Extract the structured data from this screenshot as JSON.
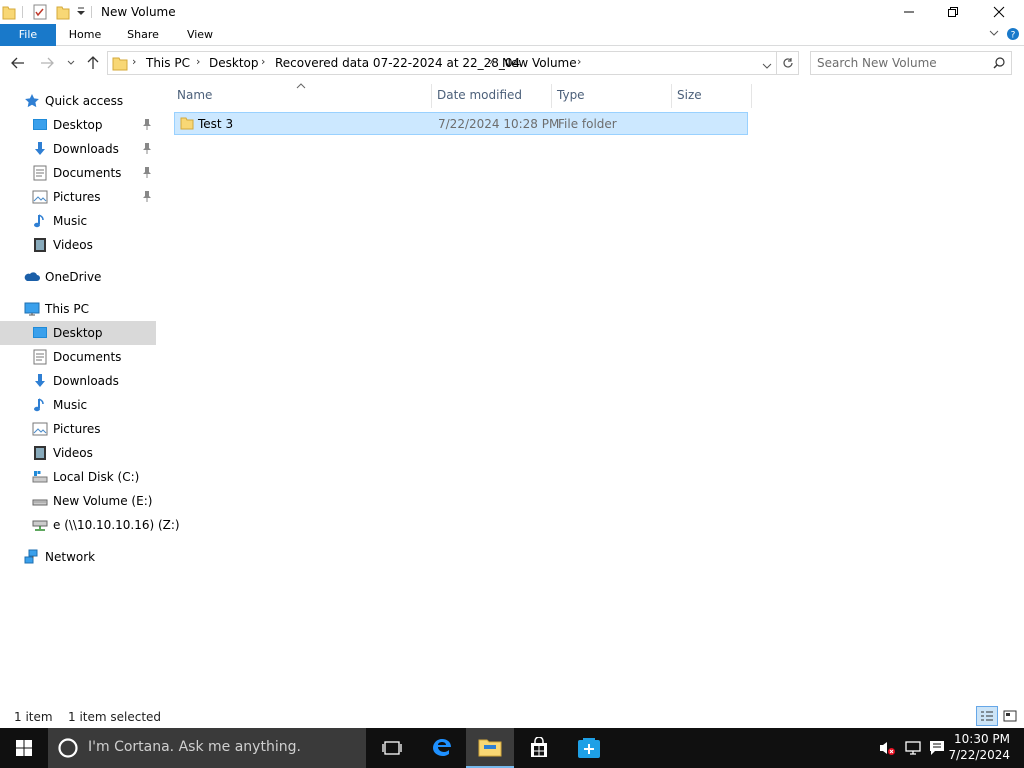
{
  "window": {
    "title": "New Volume"
  },
  "ribbon": {
    "tabs": [
      {
        "label": "File"
      },
      {
        "label": "Home"
      },
      {
        "label": "Share"
      },
      {
        "label": "View"
      }
    ]
  },
  "address": {
    "breadcrumbs": [
      "This PC",
      "Desktop",
      "Recovered data 07-22-2024 at 22_28_04",
      "New Volume"
    ]
  },
  "search": {
    "placeholder": "Search New Volume"
  },
  "nav": {
    "quick_access": {
      "label": "Quick access",
      "items": [
        {
          "label": "Desktop",
          "icon": "desktop-icon",
          "pinned": true
        },
        {
          "label": "Downloads",
          "icon": "downloads-icon",
          "pinned": true
        },
        {
          "label": "Documents",
          "icon": "documents-icon",
          "pinned": true
        },
        {
          "label": "Pictures",
          "icon": "pictures-icon",
          "pinned": true
        },
        {
          "label": "Music",
          "icon": "music-icon",
          "pinned": false
        },
        {
          "label": "Videos",
          "icon": "videos-icon",
          "pinned": false
        }
      ]
    },
    "onedrive": {
      "label": "OneDrive"
    },
    "this_pc": {
      "label": "This PC",
      "items": [
        {
          "label": "Desktop",
          "icon": "desktop-icon",
          "selected": true
        },
        {
          "label": "Documents",
          "icon": "documents-icon"
        },
        {
          "label": "Downloads",
          "icon": "downloads-icon"
        },
        {
          "label": "Music",
          "icon": "music-icon"
        },
        {
          "label": "Pictures",
          "icon": "pictures-icon"
        },
        {
          "label": "Videos",
          "icon": "videos-icon"
        },
        {
          "label": "Local Disk (C:)",
          "icon": "local-disk-icon"
        },
        {
          "label": "New Volume (E:)",
          "icon": "drive-icon"
        },
        {
          "label": "e (\\\\10.10.10.16) (Z:)",
          "icon": "network-drive-icon"
        }
      ]
    },
    "network": {
      "label": "Network"
    }
  },
  "content": {
    "columns": [
      {
        "label": "Name"
      },
      {
        "label": "Date modified"
      },
      {
        "label": "Type"
      },
      {
        "label": "Size"
      }
    ],
    "rows": [
      {
        "name": "Test 3",
        "date_modified": "7/22/2024 10:28 PM",
        "type": "File folder",
        "size": "",
        "selected": true
      }
    ]
  },
  "status": {
    "item_count": "1 item",
    "selection": "1 item selected"
  },
  "taskbar": {
    "cortana_text": "I'm Cortana. Ask me anything.",
    "clock_time": "10:30 PM",
    "clock_date": "7/22/2024"
  },
  "colors": {
    "accent": "#1979ca",
    "selection_bg": "#cce8ff",
    "selection_border": "#99d1ff",
    "taskbar_bg": "#101010",
    "folder_yellow": "#f8d775"
  }
}
